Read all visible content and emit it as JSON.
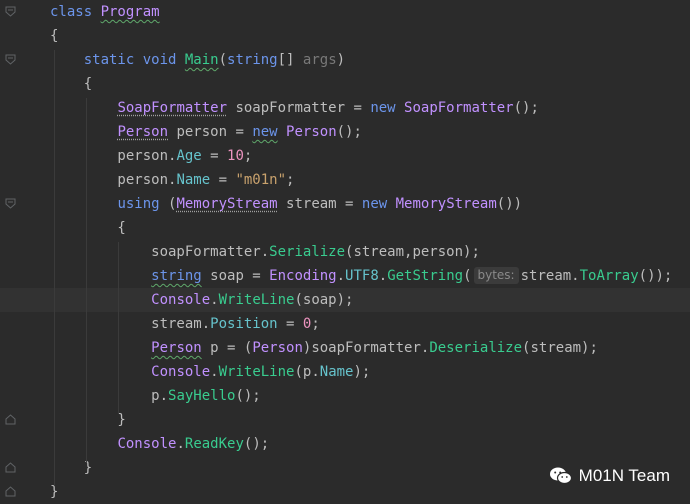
{
  "editor": {
    "lines": [
      {
        "tokens": [
          {
            "t": "class ",
            "c": "kw2"
          },
          {
            "t": "Program",
            "c": "type squig"
          }
        ]
      },
      {
        "tokens": [
          {
            "t": "{",
            "c": "plain"
          }
        ]
      },
      {
        "tokens": [
          {
            "t": "    static ",
            "c": "kw2"
          },
          {
            "t": "void ",
            "c": "kw2"
          },
          {
            "t": "Main",
            "c": "meth squig"
          },
          {
            "t": "(",
            "c": "plain"
          },
          {
            "t": "string",
            "c": "kw2"
          },
          {
            "t": "[] ",
            "c": "plain"
          },
          {
            "t": "args",
            "c": "param"
          },
          {
            "t": ")",
            "c": "plain"
          }
        ]
      },
      {
        "tokens": [
          {
            "t": "    {",
            "c": "plain"
          }
        ]
      },
      {
        "tokens": [
          {
            "t": "        ",
            "c": "plain"
          },
          {
            "t": "SoapFormatter",
            "c": "type squig-dot"
          },
          {
            "t": " soapFormatter = ",
            "c": "plain"
          },
          {
            "t": "new ",
            "c": "kw2"
          },
          {
            "t": "SoapFormatter",
            "c": "type"
          },
          {
            "t": "();",
            "c": "plain"
          }
        ]
      },
      {
        "tokens": [
          {
            "t": "        ",
            "c": "plain"
          },
          {
            "t": "Person",
            "c": "type squig-dot"
          },
          {
            "t": " person = ",
            "c": "plain"
          },
          {
            "t": "new",
            "c": "kw2 squig"
          },
          {
            "t": " ",
            "c": "plain"
          },
          {
            "t": "Person",
            "c": "type"
          },
          {
            "t": "();",
            "c": "plain"
          }
        ]
      },
      {
        "tokens": [
          {
            "t": "        person.",
            "c": "plain"
          },
          {
            "t": "Age",
            "c": "prop"
          },
          {
            "t": " = ",
            "c": "plain"
          },
          {
            "t": "10",
            "c": "num"
          },
          {
            "t": ";",
            "c": "plain"
          }
        ]
      },
      {
        "tokens": [
          {
            "t": "        person.",
            "c": "plain"
          },
          {
            "t": "Name",
            "c": "prop"
          },
          {
            "t": " = ",
            "c": "plain"
          },
          {
            "t": "\"m01n\"",
            "c": "str"
          },
          {
            "t": ";",
            "c": "plain"
          }
        ]
      },
      {
        "tokens": [
          {
            "t": "        ",
            "c": "plain"
          },
          {
            "t": "using ",
            "c": "kw2"
          },
          {
            "t": "(",
            "c": "plain"
          },
          {
            "t": "MemoryStream",
            "c": "type squig-dot"
          },
          {
            "t": " stream = ",
            "c": "plain"
          },
          {
            "t": "new ",
            "c": "kw2"
          },
          {
            "t": "MemoryStream",
            "c": "type"
          },
          {
            "t": "())",
            "c": "plain"
          }
        ]
      },
      {
        "tokens": [
          {
            "t": "        {",
            "c": "plain"
          }
        ]
      },
      {
        "tokens": [
          {
            "t": "            soapFormatter.",
            "c": "plain"
          },
          {
            "t": "Serialize",
            "c": "meth"
          },
          {
            "t": "(stream,person);",
            "c": "plain"
          }
        ]
      },
      {
        "tokens": [
          {
            "t": "            ",
            "c": "plain"
          },
          {
            "t": "string",
            "c": "kw2 squig"
          },
          {
            "t": " soap = ",
            "c": "plain"
          },
          {
            "t": "Encoding",
            "c": "type"
          },
          {
            "t": ".",
            "c": "plain"
          },
          {
            "t": "UTF8",
            "c": "prop"
          },
          {
            "t": ".",
            "c": "plain"
          },
          {
            "t": "GetString",
            "c": "meth"
          },
          {
            "t": "(",
            "c": "plain"
          },
          {
            "t": "bytes:",
            "c": "hint"
          },
          {
            "t": "stream.",
            "c": "plain"
          },
          {
            "t": "ToArray",
            "c": "meth"
          },
          {
            "t": "());",
            "c": "plain"
          }
        ]
      },
      {
        "tokens": [
          {
            "t": "            ",
            "c": "plain"
          },
          {
            "t": "Console",
            "c": "type"
          },
          {
            "t": ".",
            "c": "plain"
          },
          {
            "t": "WriteLine",
            "c": "meth"
          },
          {
            "t": "(soap);",
            "c": "plain"
          }
        ],
        "current": true
      },
      {
        "tokens": [
          {
            "t": "            stream.",
            "c": "plain"
          },
          {
            "t": "Position",
            "c": "prop"
          },
          {
            "t": " = ",
            "c": "plain"
          },
          {
            "t": "0",
            "c": "num"
          },
          {
            "t": ";",
            "c": "plain"
          }
        ]
      },
      {
        "tokens": [
          {
            "t": "            ",
            "c": "plain"
          },
          {
            "t": "Person",
            "c": "type squig"
          },
          {
            "t": " p = (",
            "c": "plain"
          },
          {
            "t": "Person",
            "c": "type"
          },
          {
            "t": ")soapFormatter.",
            "c": "plain"
          },
          {
            "t": "Deserialize",
            "c": "meth"
          },
          {
            "t": "(stream);",
            "c": "plain"
          }
        ]
      },
      {
        "tokens": [
          {
            "t": "            ",
            "c": "plain"
          },
          {
            "t": "Console",
            "c": "type"
          },
          {
            "t": ".",
            "c": "plain"
          },
          {
            "t": "WriteLine",
            "c": "meth"
          },
          {
            "t": "(p.",
            "c": "plain"
          },
          {
            "t": "Name",
            "c": "prop"
          },
          {
            "t": ");",
            "c": "plain"
          }
        ]
      },
      {
        "tokens": [
          {
            "t": "            p.",
            "c": "plain"
          },
          {
            "t": "SayHello",
            "c": "meth"
          },
          {
            "t": "();",
            "c": "plain"
          }
        ]
      },
      {
        "tokens": [
          {
            "t": "        }",
            "c": "plain"
          }
        ]
      },
      {
        "tokens": [
          {
            "t": "        ",
            "c": "plain"
          },
          {
            "t": "Console",
            "c": "type"
          },
          {
            "t": ".",
            "c": "plain"
          },
          {
            "t": "ReadKey",
            "c": "meth"
          },
          {
            "t": "();",
            "c": "plain"
          }
        ]
      },
      {
        "tokens": [
          {
            "t": "    }",
            "c": "plain"
          }
        ]
      },
      {
        "tokens": [
          {
            "t": "}",
            "c": "plain"
          }
        ]
      }
    ]
  },
  "watermark": {
    "text": "M01N Team",
    "icon": "wechat-icon"
  },
  "colors": {
    "background": "#2b2b2b",
    "current_line": "#323232",
    "keyword": "#6c95eb",
    "type": "#c191ff",
    "method": "#39cc8f",
    "property": "#66c3cc",
    "number": "#ed94c0",
    "string": "#c9a26d"
  }
}
